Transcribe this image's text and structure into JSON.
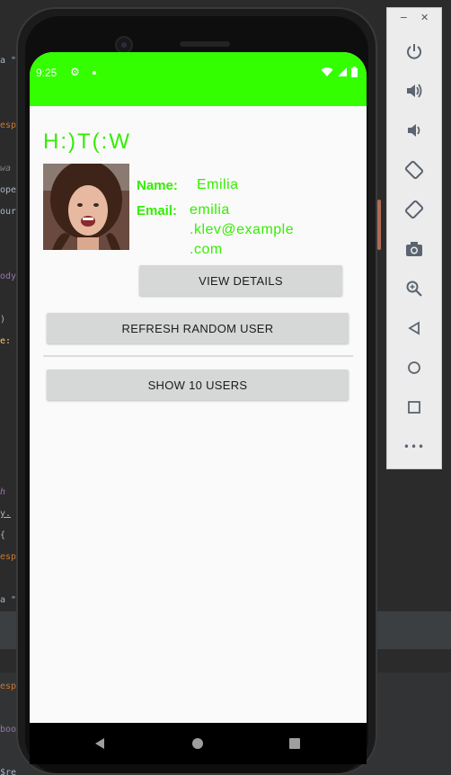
{
  "status_bar": {
    "time": "9:25",
    "color": "#33ff00"
  },
  "app": {
    "title": "H:)T(:W",
    "avatar_alt": "user-photo"
  },
  "user": {
    "name_label": "Name:",
    "name_value": "Emilia",
    "email_label": "Email:",
    "email_line1": "emilia",
    "email_line2": ".klev@example",
    "email_line3": ".com"
  },
  "buttons": {
    "view_details": "VIEW DETAILS",
    "refresh_random_user": "REFRESH RANDOM USER",
    "show_10_users": "SHOW 10 USERS"
  },
  "emulator_controls": {
    "minimize": "−",
    "close": "✕",
    "more": "•••",
    "items": [
      "power-icon",
      "volume-up-icon",
      "volume-down-icon",
      "rotate-left-icon",
      "rotate-right-icon",
      "camera-icon",
      "zoom-icon",
      "back-icon",
      "home-icon",
      "overview-icon"
    ]
  },
  "accent_color": "#33ee00"
}
